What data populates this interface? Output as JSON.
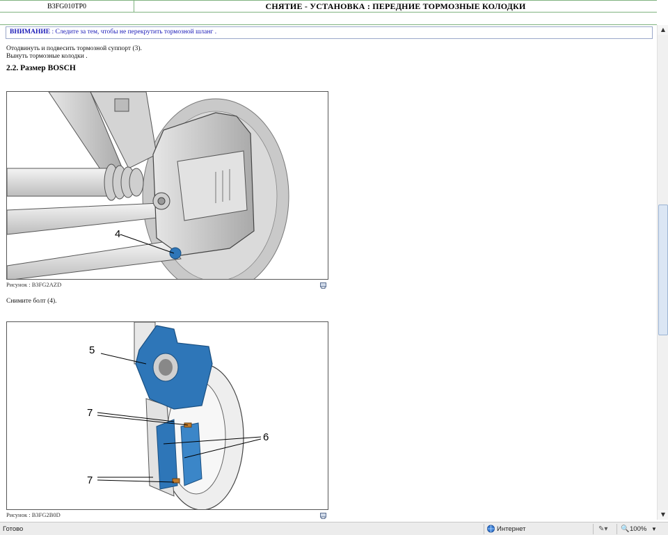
{
  "header": {
    "code": "B3FG010TP0",
    "title": "СНЯТИЕ - УСТАНОВКА : ПЕРЕДНИЕ ТОРМОЗНЫЕ КОЛОДКИ"
  },
  "warning": {
    "label": "ВНИМАНИЕ",
    "text": " : Следите за тем, чтобы не перекрутить тормозной шланг ."
  },
  "steps": [
    "Отодвинуть и подвесить тормозной суппорт (3).",
    "Вынуть тормозные колодки ."
  ],
  "section_title": "2.2. Размер BOSCH",
  "figure1": {
    "caption": "Рисунок : B3FG2AZD",
    "callouts": [
      "4"
    ]
  },
  "step_after_fig1": "Снимите болт (4).",
  "figure2": {
    "caption": "Рисунок : B3FG2B0D",
    "callouts": [
      "5",
      "7",
      "6",
      "7"
    ]
  },
  "statusbar": {
    "left": "Готово",
    "zone": "Интернет",
    "zoom": "100%"
  },
  "icons": [
    "print-icon",
    "globe-icon",
    "security-icon",
    "zoom-icon",
    "scroll-up-icon",
    "scroll-down-icon"
  ],
  "colors": {
    "warning_text": "#1a1ab8",
    "header_border": "#7fb27f",
    "caliper_blue": "#2e76b8"
  }
}
